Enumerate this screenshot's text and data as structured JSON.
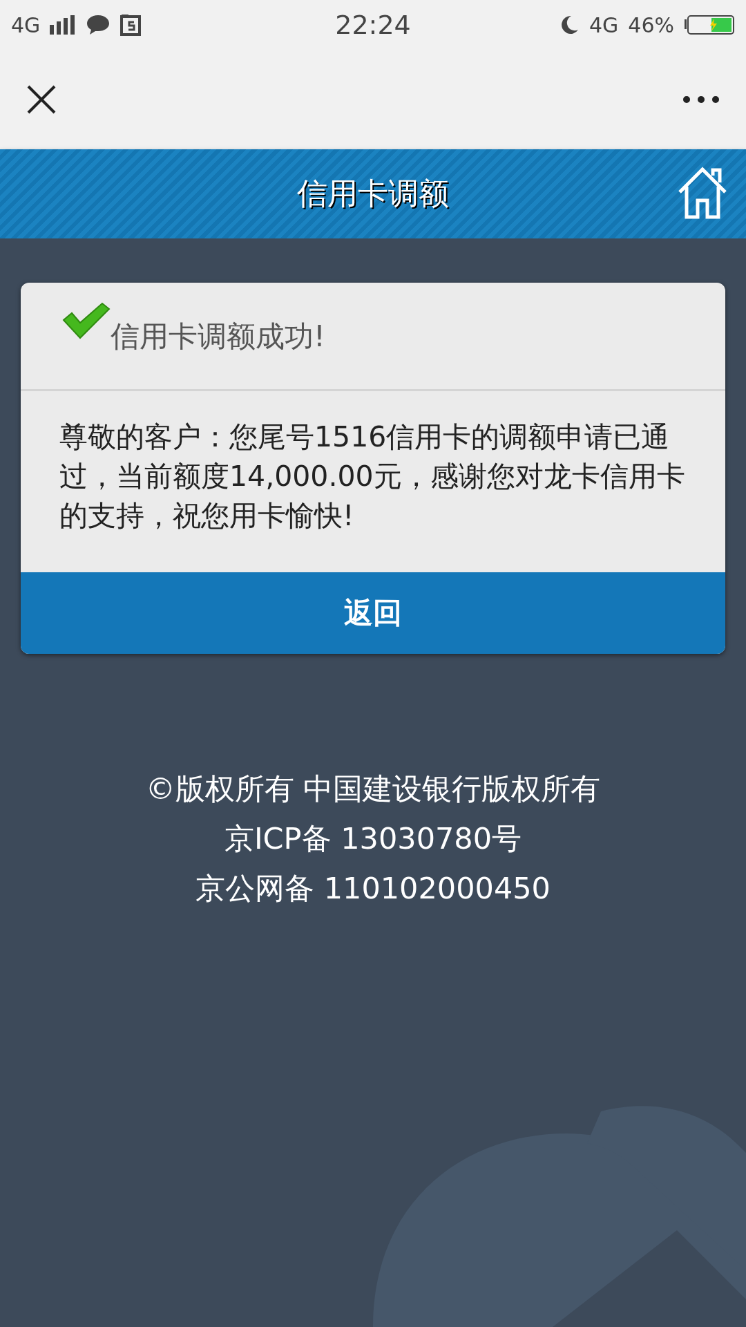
{
  "status_bar": {
    "network": "4G",
    "time": "22:24",
    "network_right": "4G",
    "battery": "46%"
  },
  "header": {
    "title": "信用卡调额"
  },
  "card": {
    "title": "信用卡调额成功!",
    "message": " 尊敬的客户：您尾号1516信用卡的调额申请已通过，当前额度14,000.00元，感谢您对龙卡信用卡的支持，祝您用卡愉快!",
    "button": "返回"
  },
  "footer": [
    "©版权所有 中国建设银行版权所有",
    "京ICP备 13030780号",
    "京公网备 110102000450"
  ]
}
